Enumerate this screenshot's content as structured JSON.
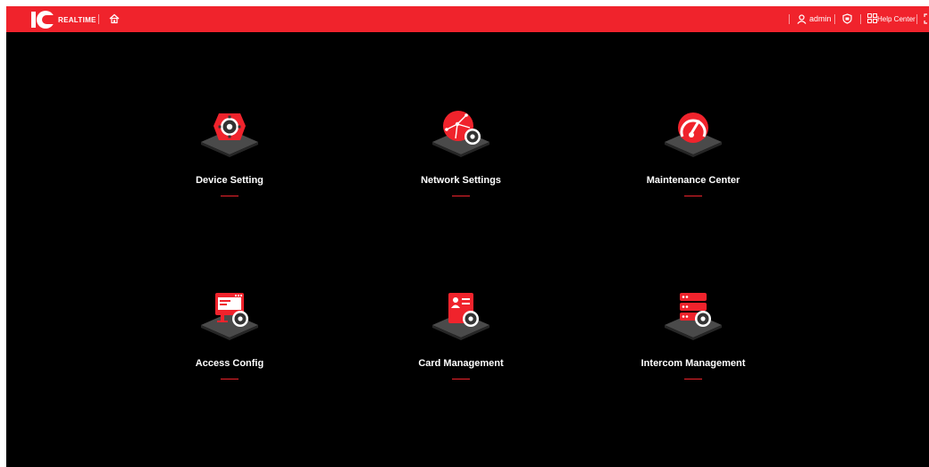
{
  "header": {
    "brand_text": "REALTIME",
    "user": "admin",
    "help_center": "Help Center"
  },
  "tiles": [
    {
      "label": "Device Setting",
      "icon": "gear-hexagon-icon"
    },
    {
      "label": "Network Settings",
      "icon": "network-globe-icon"
    },
    {
      "label": "Maintenance Center",
      "icon": "speedometer-icon"
    },
    {
      "label": "Access Config",
      "icon": "monitor-gear-icon"
    },
    {
      "label": "Card Management",
      "icon": "id-card-gear-icon"
    },
    {
      "label": "Intercom Management",
      "icon": "server-gear-icon"
    }
  ],
  "colors": {
    "accent": "#f0232c",
    "background": "#000000",
    "platform": "#4a4a4a"
  }
}
